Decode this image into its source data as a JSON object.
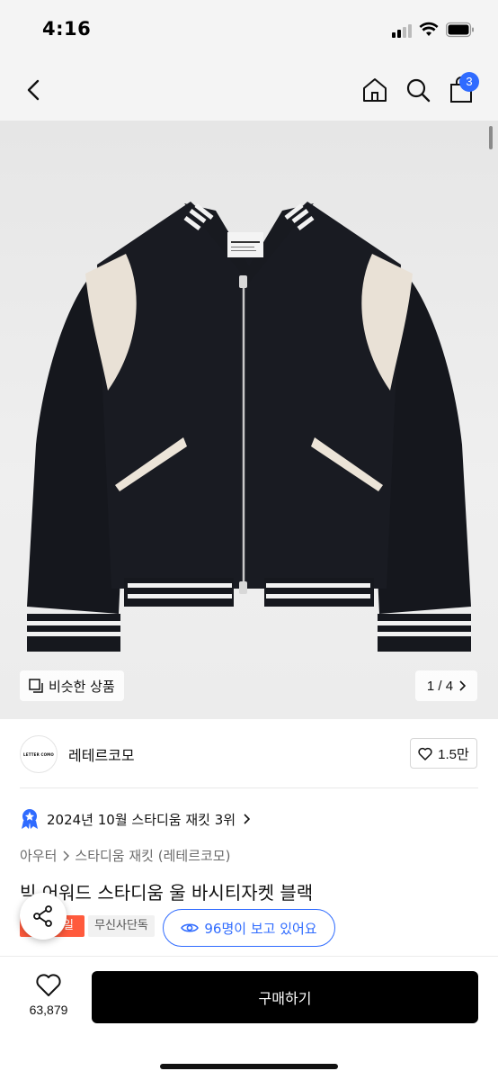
{
  "status_bar": {
    "time": "4:16"
  },
  "header": {
    "cart_count": "3"
  },
  "gallery": {
    "similar_label": "비슷한 상품",
    "pager": "1 / 4"
  },
  "brand": {
    "logo_text": "LETTER COMO",
    "name": "레테르코모",
    "likes": "1.5만"
  },
  "ranking": {
    "text": "2024년 10월 스타디움 재킷 3위"
  },
  "breadcrumb": {
    "category": "아우터",
    "subcategory": "스타디움 재킷 (레테르코모)"
  },
  "product": {
    "title": "빅 어워드 스타디움 울 바시티자켓 블랙",
    "tag_sale": "세일",
    "tag_exclusive": "무신사단독",
    "viewers": "96명이 보고 있어요"
  },
  "bottom": {
    "like_count": "63,879",
    "buy_label": "구매하기"
  },
  "colors": {
    "accent": "#2f6bff",
    "sale": "#ff5a3c",
    "buy": "#000000"
  }
}
